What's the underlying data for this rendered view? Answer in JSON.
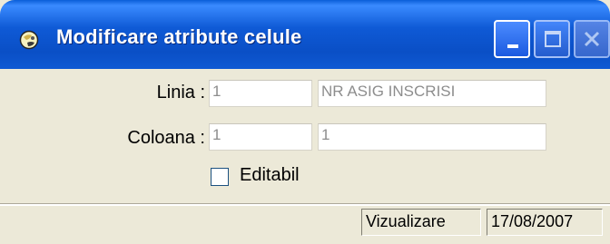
{
  "window": {
    "title": "Modificare atribute celule",
    "icon": "app-ball-icon",
    "controls": {
      "minimize": "minimize-icon",
      "maximize": "maximize-icon",
      "close": "close-icon"
    },
    "title_color": "#0a4fc6",
    "body_color": "#ece9d8"
  },
  "form": {
    "linia": {
      "label": "Linia :",
      "value1": "1",
      "value2": "NR ASIG INSCRISI"
    },
    "coloana": {
      "label": "Coloana :",
      "value1": "1",
      "value2": "1"
    },
    "editabil": {
      "label": "Editabil",
      "checked": false
    }
  },
  "status": {
    "mode": "Vizualizare",
    "date": "17/08/2007"
  }
}
